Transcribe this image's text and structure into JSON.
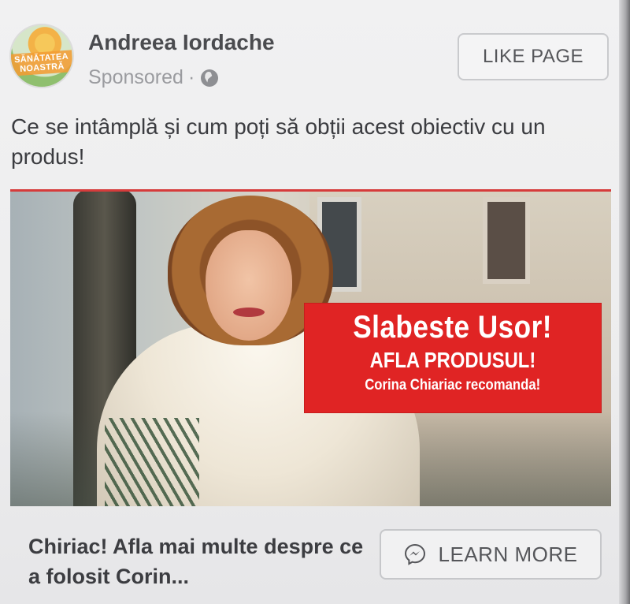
{
  "post": {
    "page_name": "Andreea Iordache",
    "sponsored_label": "Sponsored",
    "separator": "·",
    "privacy_icon": "globe-icon",
    "like_button_label": "LIKE PAGE",
    "text": "Ce se intâmplă și cum poți să obții acest obiectiv cu un produs!"
  },
  "avatar": {
    "logo_line1": "SĂNĂTATEA",
    "logo_line2": "NOASTRĂ"
  },
  "image": {
    "promo_line1": "Slabeste Usor!",
    "promo_line2": "AFLA PRODUSUL!",
    "promo_line3": "Corina Chiariac recomanda!",
    "promo_color": "#e02424"
  },
  "link": {
    "title": "Chiriac! Afla mai multe despre ce a folosit Corin...",
    "cta_label": "LEARN MORE",
    "cta_icon": "messenger-icon"
  }
}
